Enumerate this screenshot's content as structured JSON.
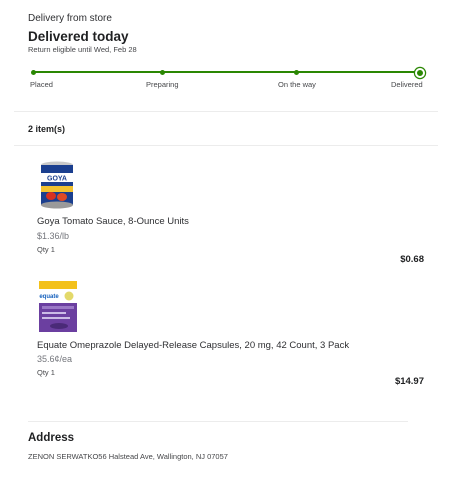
{
  "header": {
    "source": "Delivery from store",
    "status": "Delivered today",
    "return_note": "Return eligible until Wed, Feb 28"
  },
  "tracker": {
    "steps": [
      "Placed",
      "Preparing",
      "On the way",
      "Delivered"
    ],
    "accent_color": "#2a8703"
  },
  "order": {
    "items_count": "2 item(s)",
    "items": [
      {
        "name": "Goya Tomato Sauce, 8-Ounce Units",
        "unit_price": "$1.36/lb",
        "qty": "Qty 1",
        "price": "$0.68",
        "image_label": "GOYA",
        "image_icon": "goya-can-image"
      },
      {
        "name": "Equate Omeprazole Delayed-Release Capsules, 20 mg, 42 Count, 3 Pack",
        "unit_price": "35.6¢/ea",
        "qty": "Qty 1",
        "price": "$14.97",
        "image_label": "equate",
        "image_icon": "omeprazole-box-image"
      }
    ]
  },
  "address": {
    "title": "Address",
    "line": "ZENON SERWATKO56 Halstead Ave, Wallington, NJ 07057"
  }
}
